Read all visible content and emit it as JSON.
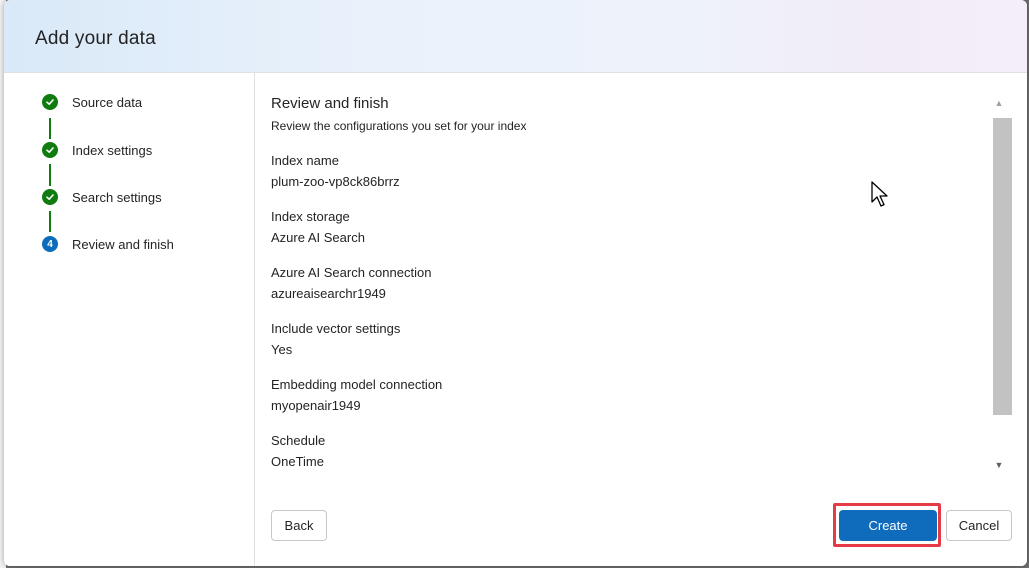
{
  "dialog": {
    "title": "Add your data"
  },
  "steps": [
    {
      "label": "Source data",
      "status": "done"
    },
    {
      "label": "Index settings",
      "status": "done"
    },
    {
      "label": "Search settings",
      "status": "done"
    },
    {
      "label": "Review and finish",
      "status": "current",
      "number": "4"
    }
  ],
  "review": {
    "title": "Review and finish",
    "subtitle": "Review the configurations you set for your index",
    "fields": [
      {
        "label": "Index name",
        "value": "plum-zoo-vp8ck86brrz"
      },
      {
        "label": "Index storage",
        "value": "Azure AI Search"
      },
      {
        "label": "Azure AI Search connection",
        "value": "azureaisearchr1949"
      },
      {
        "label": "Include vector settings",
        "value": "Yes"
      },
      {
        "label": "Embedding model connection",
        "value": "myopenair1949"
      },
      {
        "label": "Schedule",
        "value": "OneTime"
      }
    ]
  },
  "buttons": {
    "back": "Back",
    "create": "Create",
    "cancel": "Cancel"
  },
  "colors": {
    "accent": "#0f6cbd",
    "success": "#107c10",
    "highlight": "#e63b46"
  },
  "icons": {
    "step_done": "checkmark-circle-icon",
    "scroll_up": "caret-up-icon",
    "scroll_down": "caret-down-icon",
    "cursor": "mouse-pointer-icon"
  }
}
